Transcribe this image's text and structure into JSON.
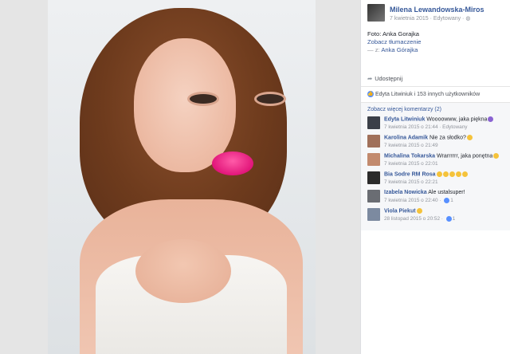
{
  "post": {
    "author": "Milena Lewandowska-Miros",
    "meta": "7 kwietnia 2015 · Edytowany · ",
    "caption_line1": "Foto: Anka Gorajka",
    "translation_link": "Zobacz tłumaczenie",
    "with_prefix": "— z: ",
    "with_name": "Anka Górajka"
  },
  "actions": {
    "share_label": "Udostępnij"
  },
  "likes": {
    "text": "Edyta Litwiniuk i 153 innych użytkowników"
  },
  "comments": {
    "more_label": "Zobacz więcej komentarzy (2)",
    "items": [
      {
        "author": "Edyta Litwiniuk",
        "text": "Woooowww, jaka piękna",
        "time": "7 kwietnia 2015 o 21:44 · Edytowany",
        "likes": "",
        "avatar_color": "#3b3f48"
      },
      {
        "author": "Karolina Adamik",
        "text": "Nie za słodko?",
        "time": "7 kwietnia 2015 o 21:49",
        "likes": "",
        "avatar_color": "#a0705a"
      },
      {
        "author": "Michalina Tokarska",
        "text": "Wrarrrrrr, jaka ponętna",
        "time": "7 kwietnia 2015 o 22:01",
        "likes": "",
        "avatar_color": "#c28a6e"
      },
      {
        "author": "Bia Sodre RM Rosa",
        "text": "",
        "time": "7 kwietnia 2015 o 22:21",
        "likes": "",
        "avatar_color": "#2b2b2b"
      },
      {
        "author": "Izabela Nowicka",
        "text": "Ale ustalsuper!",
        "time": "7 kwietnia 2015 o 22:40 · ",
        "likes": "1",
        "avatar_color": "#6a6d73"
      },
      {
        "author": "Viola Piekut",
        "text": "",
        "time": "28 listopad 2015 o 20:52 · ",
        "likes": "1",
        "avatar_color": "#7c8aa0"
      }
    ]
  },
  "colors": {
    "link": "#365899",
    "like_blue": "#5890ff",
    "lips": "#e2167a"
  }
}
